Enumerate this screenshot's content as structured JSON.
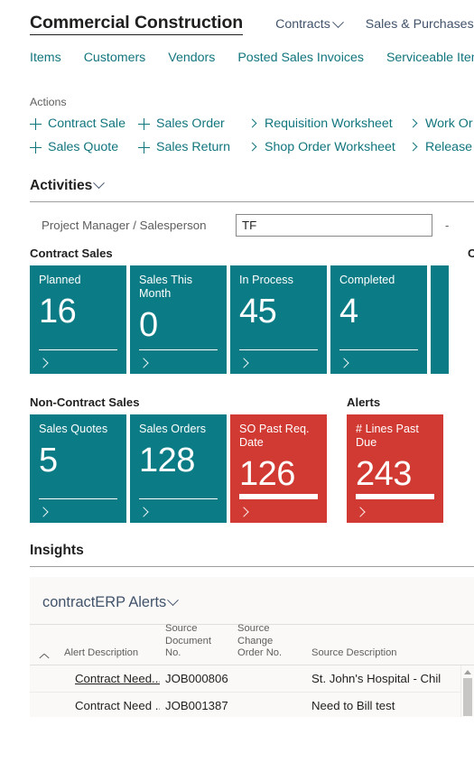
{
  "header": {
    "company_title": "Commercial Construction",
    "menus": [
      {
        "label": "Contracts",
        "icon": "chevron-down-icon"
      },
      {
        "label": "Sales & Purchases",
        "icon": "chevron-down-icon"
      }
    ],
    "links": [
      "Items",
      "Customers",
      "Vendors",
      "Posted Sales Invoices",
      "Serviceable Items"
    ]
  },
  "actions": {
    "caption": "Actions",
    "items": [
      {
        "label": "Contract Sale",
        "icon": "plus-icon"
      },
      {
        "label": "Sales Order",
        "icon": "plus-icon"
      },
      {
        "label": "Requisition Worksheet",
        "icon": "arrow-right-icon"
      },
      {
        "label": "Work Or",
        "icon": "arrow-right-icon"
      },
      {
        "label": "Sales Quote",
        "icon": "plus-icon"
      },
      {
        "label": "Sales Return",
        "icon": "plus-icon"
      },
      {
        "label": "Shop Order Worksheet",
        "icon": "arrow-right-icon"
      },
      {
        "label": "Release",
        "icon": "arrow-right-icon"
      }
    ]
  },
  "activities": {
    "title": "Activities",
    "icon": "chevron-down-icon",
    "filter": {
      "label": "Project Manager / Salesperson",
      "value": "TF",
      "placeholder": "",
      "trailing": "-"
    },
    "groups": [
      {
        "label": "Contract Sales",
        "tiles": [
          {
            "title": "Planned",
            "value": "16",
            "color": "#0b7c86",
            "style": "teal"
          },
          {
            "title": "Sales This Month",
            "value": "0",
            "color": "#0b7c86",
            "style": "teal"
          },
          {
            "title": "In Process",
            "value": "45",
            "color": "#0b7c86",
            "style": "teal"
          },
          {
            "title": "Completed",
            "value": "4",
            "color": "#0b7c86",
            "style": "teal"
          }
        ],
        "cutoff_label": "C"
      },
      {
        "label": "Non-Contract Sales",
        "tiles": [
          {
            "title": "Sales Quotes",
            "value": "5",
            "color": "#0b7c86",
            "style": "teal"
          },
          {
            "title": "Sales Orders",
            "value": "128",
            "color": "#0b7c86",
            "style": "teal"
          },
          {
            "title": "SO Past Req. Date",
            "value": "126",
            "color": "#d13a32",
            "style": "red"
          }
        ]
      },
      {
        "label": "Alerts",
        "tiles": [
          {
            "title": "# Lines Past Due",
            "value": "243",
            "color": "#d13a32",
            "style": "red"
          }
        ]
      }
    ]
  },
  "insights": {
    "title": "Insights",
    "card": {
      "title": "contractERP Alerts",
      "icon": "chevron-down-icon",
      "table": {
        "sort_icon": "caret-up-icon",
        "columns": [
          "Alert Description",
          "Source Document No.",
          "Source Change Order No.",
          "Source Description"
        ],
        "rows": [
          {
            "alert_description": "Contract Need...",
            "source_document_no": "JOB000806",
            "source_change_order_no": "",
            "source_description": "St. John's Hospital - Chil",
            "selected": true,
            "menu_icon": "kebab-menu-icon"
          },
          {
            "alert_description": "Contract Need ...",
            "source_document_no": "JOB001387",
            "source_change_order_no": "",
            "source_description": "Need to Bill test",
            "selected": false,
            "menu_icon": ""
          }
        ]
      },
      "scrollbar": {
        "up_icon": "scroll-up-arrow-icon"
      }
    }
  },
  "colors": {
    "teal": "#0b7c86",
    "red": "#d13a32",
    "link": "#11757e",
    "nav": "#41536b"
  }
}
